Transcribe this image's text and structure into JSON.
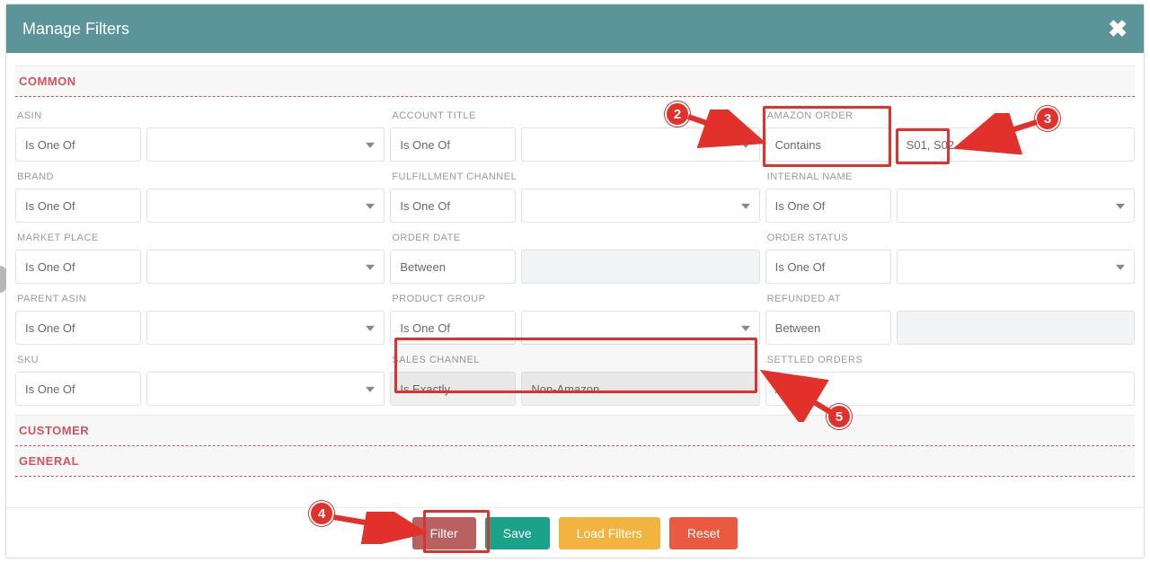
{
  "header": {
    "title": "Manage Filters"
  },
  "sections": {
    "common": "COMMON",
    "customer": "CUSTOMER",
    "general": "GENERAL"
  },
  "is_one_of": "Is One Of",
  "between": "Between",
  "col1": {
    "asin": {
      "label": "ASIN"
    },
    "brand": {
      "label": "BRAND"
    },
    "marketplace": {
      "label": "MARKET PLACE"
    },
    "parent_asin": {
      "label": "PARENT ASIN"
    },
    "sku": {
      "label": "SKU"
    }
  },
  "col2": {
    "account_title": {
      "label": "ACCOUNT TITLE"
    },
    "fulfillment_channel": {
      "label": "FULFILLMENT CHANNEL"
    },
    "order_date": {
      "label": "ORDER DATE"
    },
    "product_group": {
      "label": "PRODUCT GROUP"
    },
    "sales_channel": {
      "label": "SALES CHANNEL",
      "op": "Is Exactly",
      "value": "Non-Amazon"
    }
  },
  "col3": {
    "amazon_order": {
      "label": "AMAZON ORDER",
      "op": "Contains",
      "value": "S01, S02"
    },
    "internal_name": {
      "label": "INTERNAL NAME"
    },
    "order_status": {
      "label": "ORDER STATUS"
    },
    "refunded_at": {
      "label": "REFUNDED AT"
    },
    "settled_orders": {
      "label": "SETTLED ORDERS",
      "value": "All"
    }
  },
  "footer": {
    "filter": "Filter",
    "save": "Save",
    "load": "Load Filters",
    "reset": "Reset"
  },
  "badges": {
    "b2": "2",
    "b3": "3",
    "b4": "4",
    "b5": "5"
  }
}
